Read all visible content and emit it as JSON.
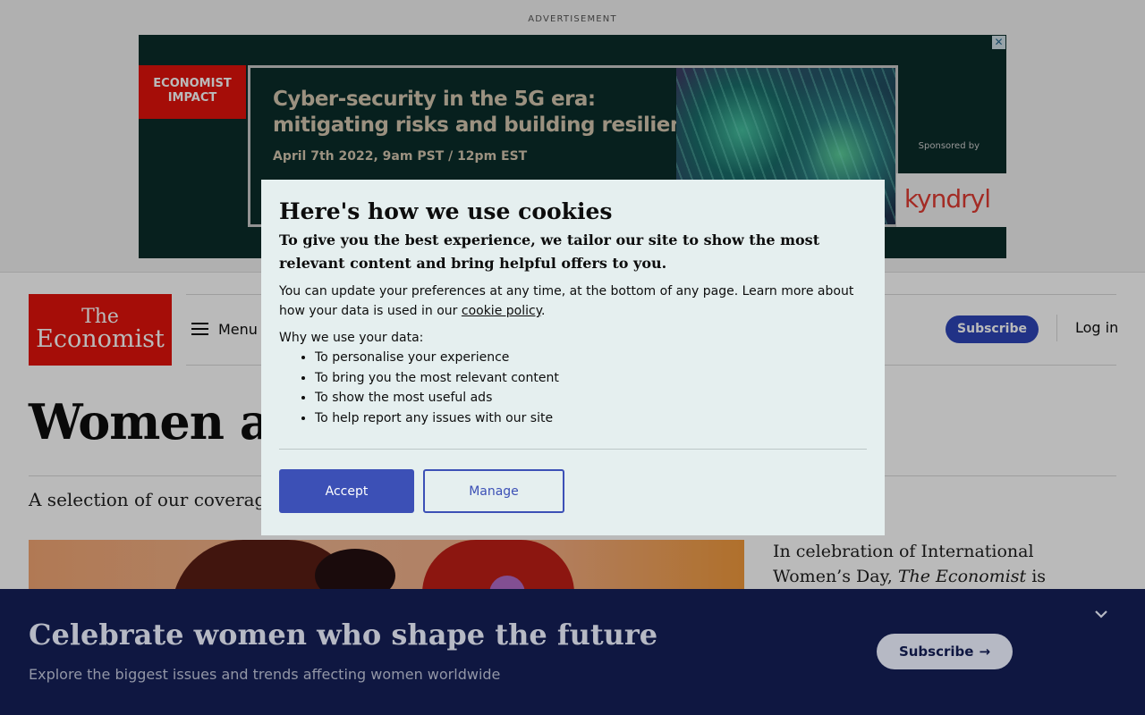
{
  "ad": {
    "label": "ADVERTISEMENT",
    "close": "✕",
    "brand_line1": "ECONOMIST",
    "brand_line2": "IMPACT",
    "headline_line1": "Cyber-security in the 5G era:",
    "headline_line2": "mitigating risks and building resilience",
    "date": "April 7th 2022, 9am PST / 12pm EST",
    "sponsored_by": "Sponsored by",
    "sponsor": "kyndryl"
  },
  "header": {
    "logo_line1": "The",
    "logo_line2": "Economist",
    "menu_label": "Menu",
    "subscribe_label": "Subscribe",
    "login_label": "Log in"
  },
  "page": {
    "title": "Women and",
    "intro": "A selection of our coverage",
    "side_text_1": "In celebration of International Women’s Day, ",
    "side_text_em": "The Economist",
    "side_text_2": " is highlighting some of"
  },
  "cookie": {
    "title": "Here's how we use cookies",
    "lead": "To give you the best experience, we tailor our site to show the most relevant content and bring helpful offers to you.",
    "para_before_link": "You can update your preferences at any time, at the bottom of any page. Learn more about how your data is used in our ",
    "link": "cookie policy",
    "para_after_link": ".",
    "why_heading": "Why we use your data:",
    "reasons": [
      "To personalise your experience",
      "To bring you the most relevant content",
      "To show the most useful ads",
      "To help report any issues with our site"
    ],
    "accept_label": "Accept",
    "manage_label": "Manage"
  },
  "promo": {
    "title": "Celebrate women who shape the future",
    "subtitle": "Explore the biggest issues and trends affecting women worldwide",
    "subscribe_label": "Subscribe",
    "arrow": "→"
  }
}
